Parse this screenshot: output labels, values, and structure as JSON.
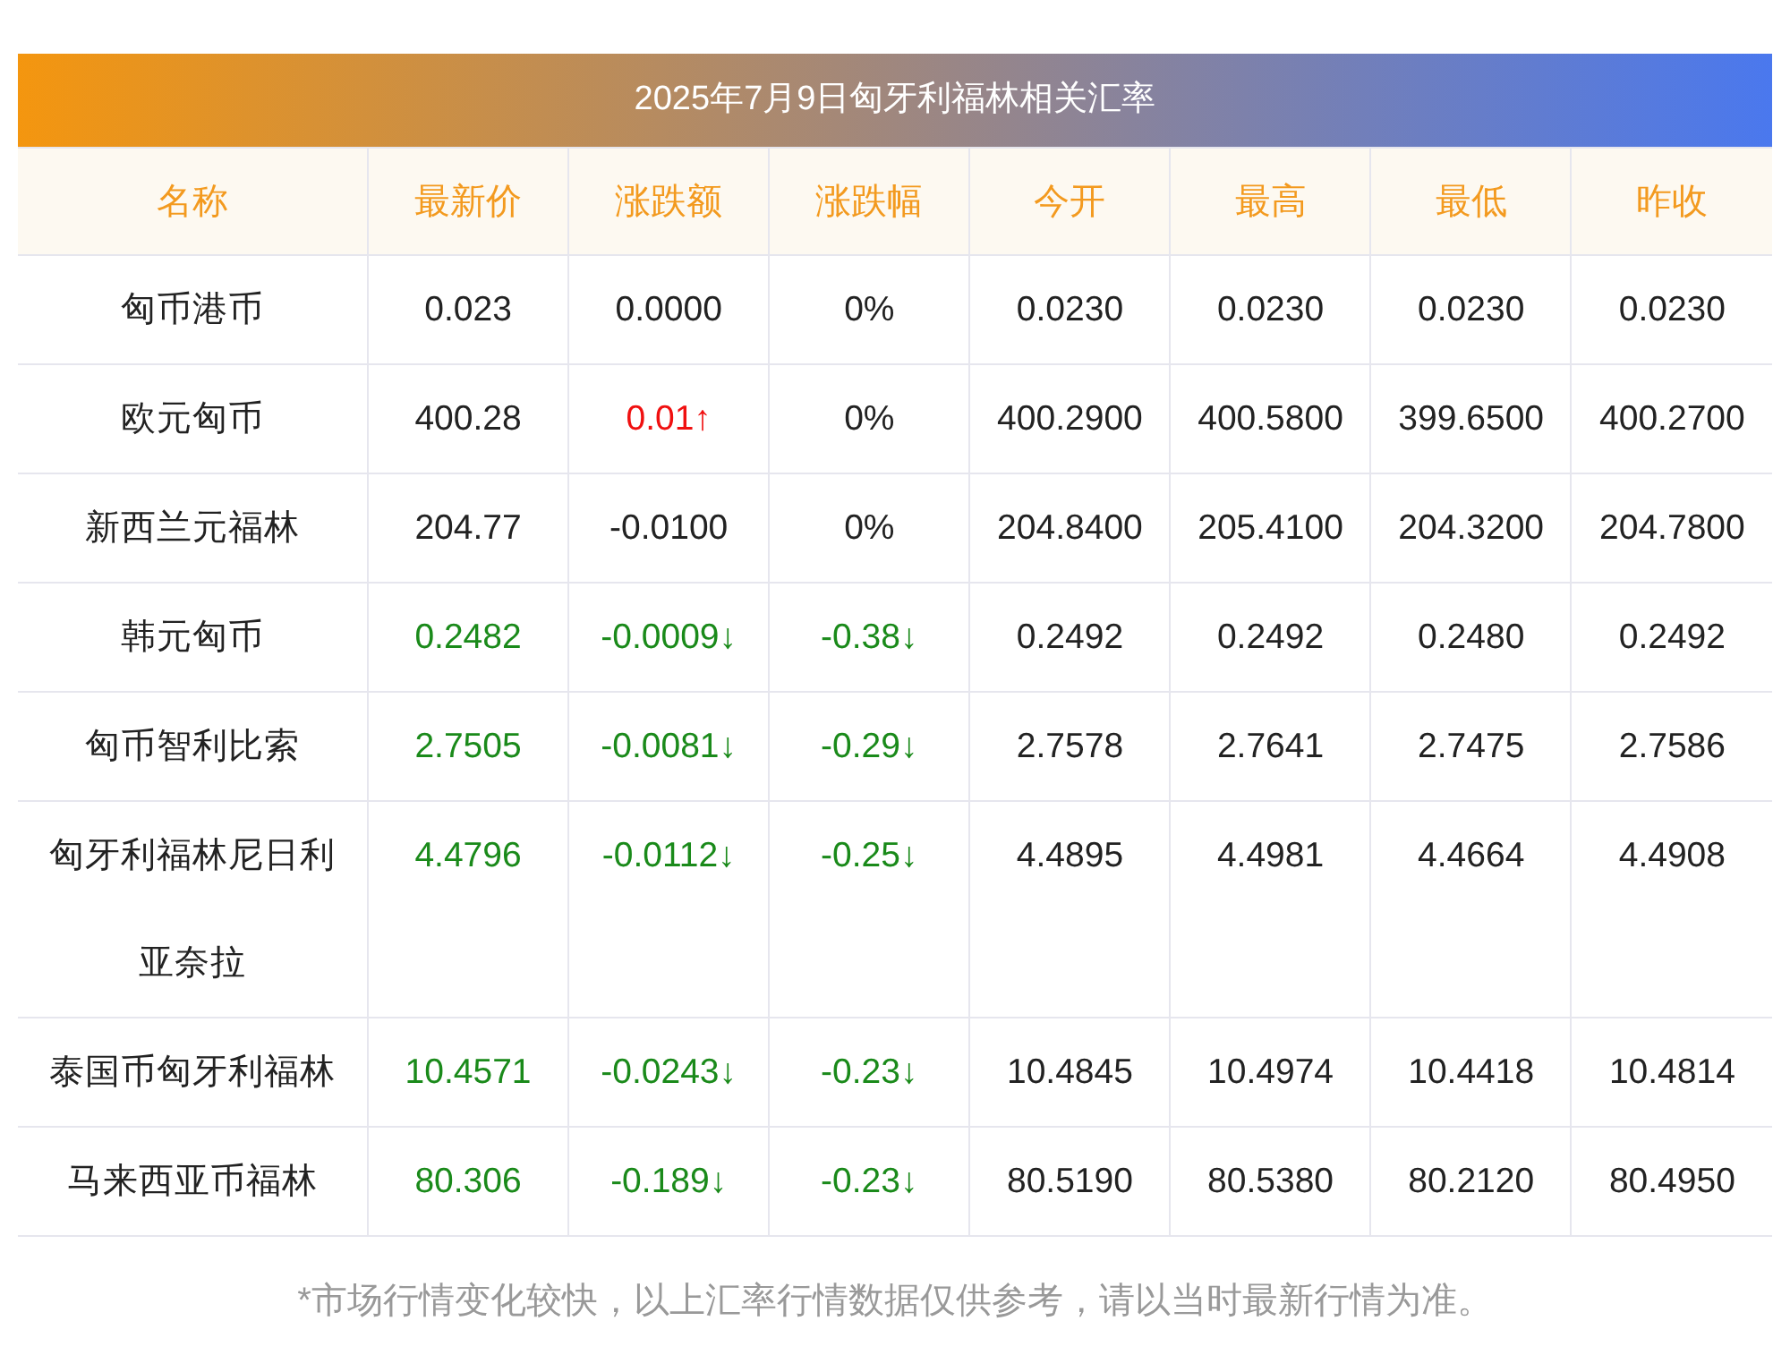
{
  "title": "2025年7月9日匈牙利福林相关汇率",
  "columns": [
    "名称",
    "最新价",
    "涨跌额",
    "涨跌幅",
    "今开",
    "最高",
    "最低",
    "昨收"
  ],
  "rows": [
    {
      "name": "匈币港币",
      "cells": [
        {
          "text": "0.023",
          "color": "#222222"
        },
        {
          "text": "0.0000",
          "color": "#222222"
        },
        {
          "text": "0%",
          "color": "#222222"
        },
        {
          "text": "0.0230",
          "color": "#222222"
        },
        {
          "text": "0.0230",
          "color": "#222222"
        },
        {
          "text": "0.0230",
          "color": "#222222"
        },
        {
          "text": "0.0230",
          "color": "#222222"
        }
      ]
    },
    {
      "name": "欧元匈币",
      "cells": [
        {
          "text": "400.28",
          "color": "#222222"
        },
        {
          "text": "0.01↑",
          "color": "#f01010"
        },
        {
          "text": "0%",
          "color": "#222222"
        },
        {
          "text": "400.2900",
          "color": "#222222"
        },
        {
          "text": "400.5800",
          "color": "#222222"
        },
        {
          "text": "399.6500",
          "color": "#222222"
        },
        {
          "text": "400.2700",
          "color": "#222222"
        }
      ]
    },
    {
      "name": "新西兰元福林",
      "cells": [
        {
          "text": "204.77",
          "color": "#222222"
        },
        {
          "text": "-0.0100",
          "color": "#222222"
        },
        {
          "text": "0%",
          "color": "#222222"
        },
        {
          "text": "204.8400",
          "color": "#222222"
        },
        {
          "text": "205.4100",
          "color": "#222222"
        },
        {
          "text": "204.3200",
          "color": "#222222"
        },
        {
          "text": "204.7800",
          "color": "#222222"
        }
      ]
    },
    {
      "name": "韩元匈币",
      "cells": [
        {
          "text": "0.2482",
          "color": "#1a8a1a"
        },
        {
          "text": "-0.0009↓",
          "color": "#1a8a1a"
        },
        {
          "text": "-0.38↓",
          "color": "#1a8a1a"
        },
        {
          "text": "0.2492",
          "color": "#222222"
        },
        {
          "text": "0.2492",
          "color": "#222222"
        },
        {
          "text": "0.2480",
          "color": "#222222"
        },
        {
          "text": "0.2492",
          "color": "#222222"
        }
      ]
    },
    {
      "name": "匈币智利比索",
      "cells": [
        {
          "text": "2.7505",
          "color": "#1a8a1a"
        },
        {
          "text": "-0.0081↓",
          "color": "#1a8a1a"
        },
        {
          "text": "-0.29↓",
          "color": "#1a8a1a"
        },
        {
          "text": "2.7578",
          "color": "#222222"
        },
        {
          "text": "2.7641",
          "color": "#222222"
        },
        {
          "text": "2.7475",
          "color": "#222222"
        },
        {
          "text": "2.7586",
          "color": "#222222"
        }
      ]
    },
    {
      "name": "匈牙利福林尼日利亚奈拉",
      "cells": [
        {
          "text": "4.4796",
          "color": "#1a8a1a"
        },
        {
          "text": "-0.0112↓",
          "color": "#1a8a1a"
        },
        {
          "text": "-0.25↓",
          "color": "#1a8a1a"
        },
        {
          "text": "4.4895",
          "color": "#222222"
        },
        {
          "text": "4.4981",
          "color": "#222222"
        },
        {
          "text": "4.4664",
          "color": "#222222"
        },
        {
          "text": "4.4908",
          "color": "#222222"
        }
      ]
    },
    {
      "name": "泰国币匈牙利福林",
      "cells": [
        {
          "text": "10.4571",
          "color": "#1a8a1a"
        },
        {
          "text": "-0.0243↓",
          "color": "#1a8a1a"
        },
        {
          "text": "-0.23↓",
          "color": "#1a8a1a"
        },
        {
          "text": "10.4845",
          "color": "#222222"
        },
        {
          "text": "10.4974",
          "color": "#222222"
        },
        {
          "text": "10.4418",
          "color": "#222222"
        },
        {
          "text": "10.4814",
          "color": "#222222"
        }
      ]
    },
    {
      "name": "马来西亚币福林",
      "cells": [
        {
          "text": "80.306",
          "color": "#1a8a1a"
        },
        {
          "text": "-0.189↓",
          "color": "#1a8a1a"
        },
        {
          "text": "-0.23↓",
          "color": "#1a8a1a"
        },
        {
          "text": "80.5190",
          "color": "#222222"
        },
        {
          "text": "80.5380",
          "color": "#222222"
        },
        {
          "text": "80.2120",
          "color": "#222222"
        },
        {
          "text": "80.4950",
          "color": "#222222"
        }
      ]
    }
  ],
  "note": "*市场行情变化较快，以上汇率行情数据仅供参考，请以当时最新行情为准。"
}
